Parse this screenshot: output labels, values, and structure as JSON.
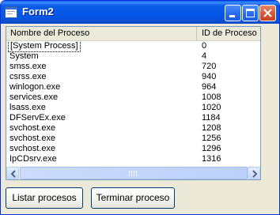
{
  "window": {
    "title": "Form2"
  },
  "titlebar": {
    "icon": "app-window-icon",
    "buttons": {
      "minimize": "minimize-icon",
      "maximize": "maximize-icon",
      "close": "close-icon"
    }
  },
  "listview": {
    "columns": [
      "Nombre del Proceso",
      "ID de Proceso"
    ],
    "rows": [
      {
        "name": "[System Process]",
        "pid": "0"
      },
      {
        "name": "System",
        "pid": "4"
      },
      {
        "name": "smss.exe",
        "pid": "720"
      },
      {
        "name": "csrss.exe",
        "pid": "940"
      },
      {
        "name": "winlogon.exe",
        "pid": "964"
      },
      {
        "name": "services.exe",
        "pid": "1008"
      },
      {
        "name": "lsass.exe",
        "pid": "1020"
      },
      {
        "name": "DFServEx.exe",
        "pid": "1184"
      },
      {
        "name": "svchost.exe",
        "pid": "1208"
      },
      {
        "name": "svchost.exe",
        "pid": "1256"
      },
      {
        "name": "svchost.exe",
        "pid": "1296"
      },
      {
        "name": "IpCDsrv.exe",
        "pid": "1316"
      }
    ],
    "scrollbars": {
      "up": "arrow-up-icon",
      "down": "arrow-down-icon",
      "left": "arrow-left-icon",
      "right": "arrow-right-icon"
    }
  },
  "buttons": {
    "list": "Listar procesos",
    "kill": "Terminar proceso"
  },
  "colors": {
    "titlebar": "#0556e6",
    "window_bg": "#ece9d8",
    "close_button": "#d95a3a"
  }
}
